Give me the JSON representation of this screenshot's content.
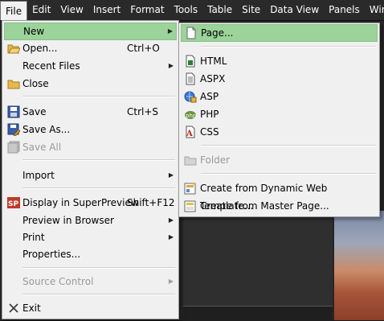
{
  "menubar": {
    "items": [
      "File",
      "Edit",
      "View",
      "Insert",
      "Format",
      "Tools",
      "Table",
      "Site",
      "Data View",
      "Panels",
      "Window"
    ]
  },
  "file_menu": {
    "new": "New",
    "open": "Open...",
    "open_shortcut": "Ctrl+O",
    "recent_files": "Recent Files",
    "close": "Close",
    "save": "Save",
    "save_shortcut": "Ctrl+S",
    "save_as": "Save As...",
    "save_all": "Save All",
    "import": "Import",
    "superpreview": "Display in SuperPreview",
    "superpreview_shortcut": "Shift+F12",
    "preview_browser": "Preview in Browser",
    "print": "Print",
    "properties": "Properties...",
    "source_control": "Source Control",
    "exit": "Exit"
  },
  "new_menu": {
    "page": "Page...",
    "html": "HTML",
    "aspx": "ASPX",
    "asp": "ASP",
    "php": "PHP",
    "css": "CSS",
    "folder": "Folder",
    "dwt": "Create from Dynamic Web Template...",
    "master": "Create from Master Page..."
  },
  "colors": {
    "highlight": "#9bd39a",
    "menu_bg": "#f0f0f0",
    "menubar_bg": "#2a2a2a"
  }
}
